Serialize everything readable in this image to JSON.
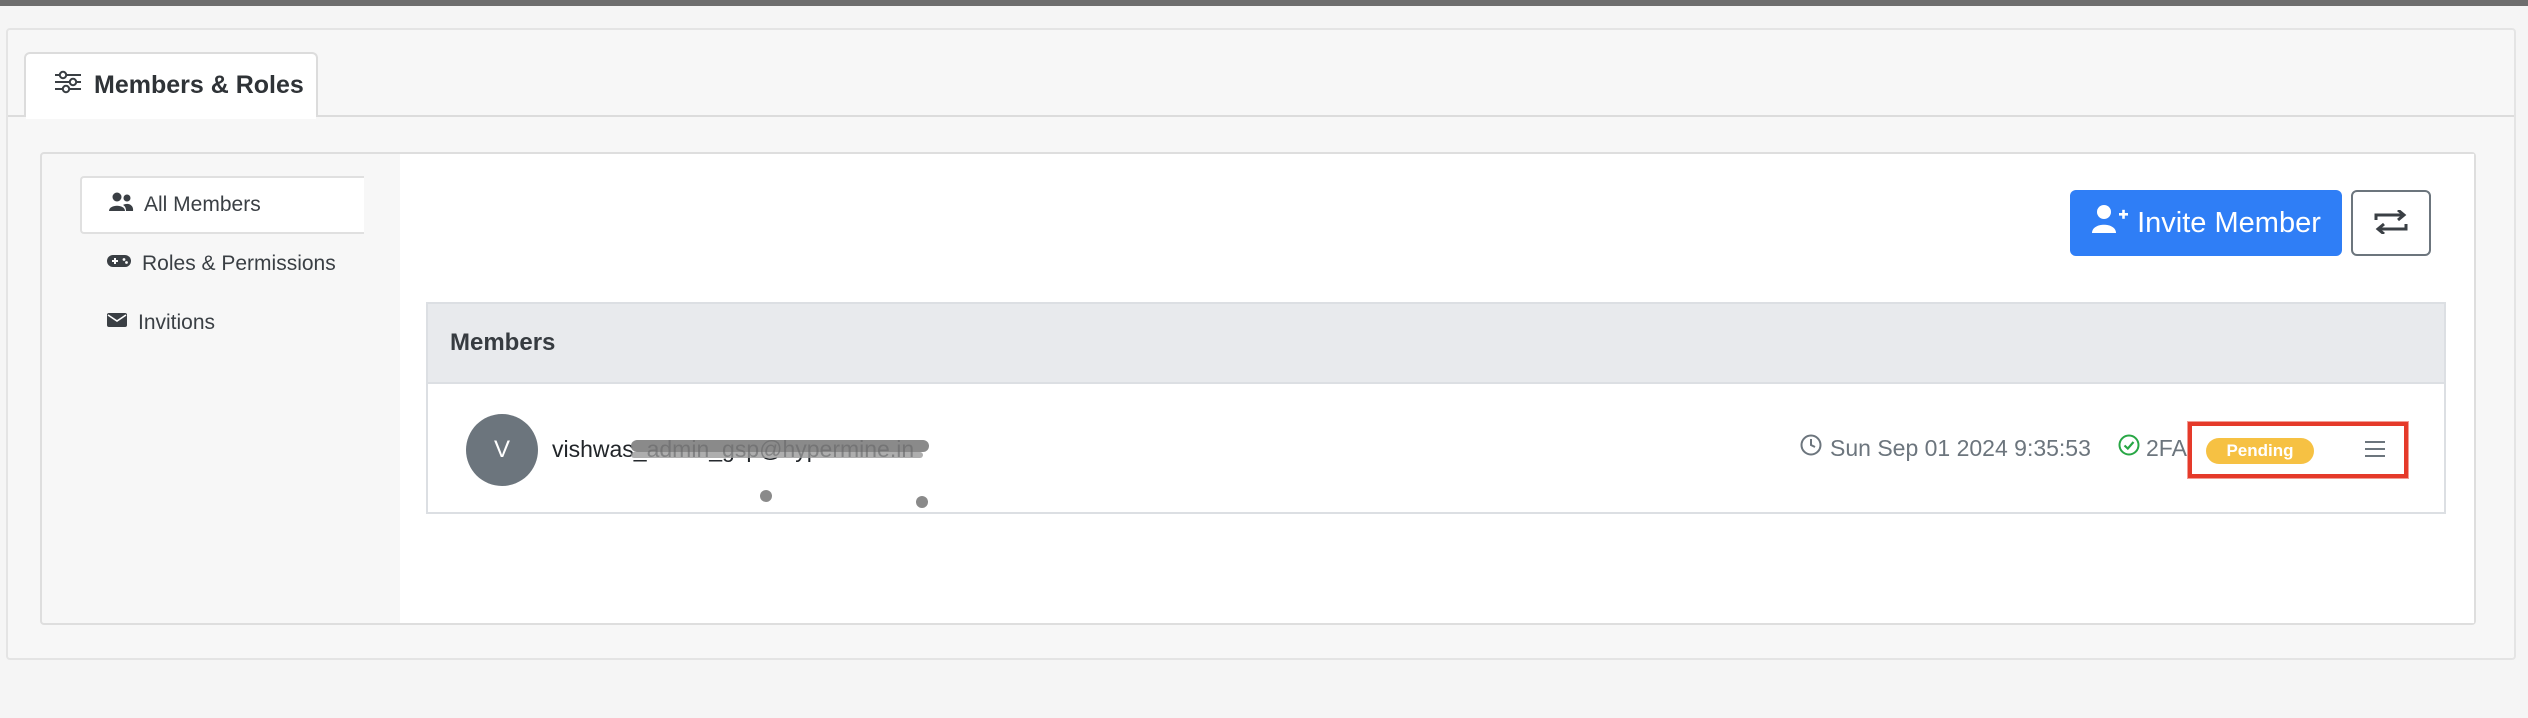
{
  "tab": {
    "label": "Members & Roles",
    "icon": "sliders-icon"
  },
  "sidebar": {
    "items": [
      {
        "label": "All Members",
        "icon": "users-icon",
        "active": true
      },
      {
        "label": "Roles & Permissions",
        "icon": "gamepad-icon",
        "active": false
      },
      {
        "label": "Invitions",
        "icon": "envelope-icon",
        "active": false
      }
    ]
  },
  "toolbar": {
    "invite_label": "Invite Member",
    "invite_icon": "user-plus-icon",
    "transfer_icon": "transfer-arrows-icon"
  },
  "members": {
    "header": "Members",
    "rows": [
      {
        "avatar_initial": "V",
        "email": "vishwas_admin_gsp@hypermine.in",
        "timestamp": "Sun Sep 01 2024 9:35:53",
        "twofa_label": "2FA",
        "status": "Pending"
      }
    ]
  },
  "colors": {
    "primary": "#2f7ef6",
    "pending_badge": "#f6c143",
    "highlight": "#e53a2a",
    "twofa_check": "#28a745",
    "avatar_bg": "#6c757d"
  }
}
